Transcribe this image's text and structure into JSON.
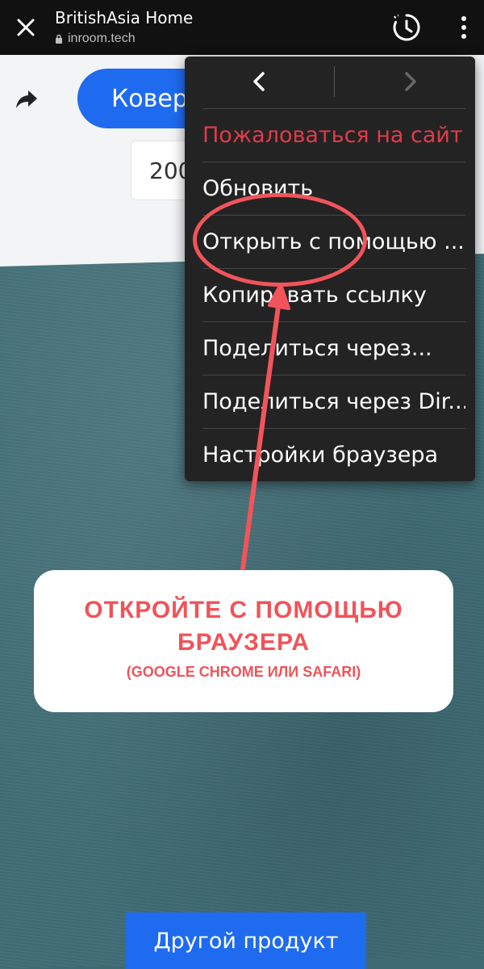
{
  "app_bar": {
    "title": "BritishAsia Home",
    "url": "inroom.tech",
    "close_icon": "close-icon",
    "history_icon": "history-icon",
    "more_icon": "more-vert-icon"
  },
  "page": {
    "pill_label": "Ковер",
    "year_fragment": "200",
    "bottom_button_label": "Другой продукт"
  },
  "menu": {
    "items": [
      {
        "label": "Пожаловаться на сайт",
        "color": "#e23b4a"
      },
      {
        "label": "Обновить"
      },
      {
        "label": "Открыть с помощью ..."
      },
      {
        "label": "Копировать ссылку"
      },
      {
        "label": "Поделиться через..."
      },
      {
        "label": "Поделиться через Dir..."
      },
      {
        "label": "Настройки браузера"
      }
    ]
  },
  "callout": {
    "line1": "ОТКРОЙТЕ С ПОМОЩЬЮ",
    "line2": "БРАУЗЕРА",
    "line3": "(GOOGLE CHROME ИЛИ SAFARI)"
  },
  "colors": {
    "annotation_red": "#f05359",
    "accent_blue": "#1f6bf0"
  }
}
